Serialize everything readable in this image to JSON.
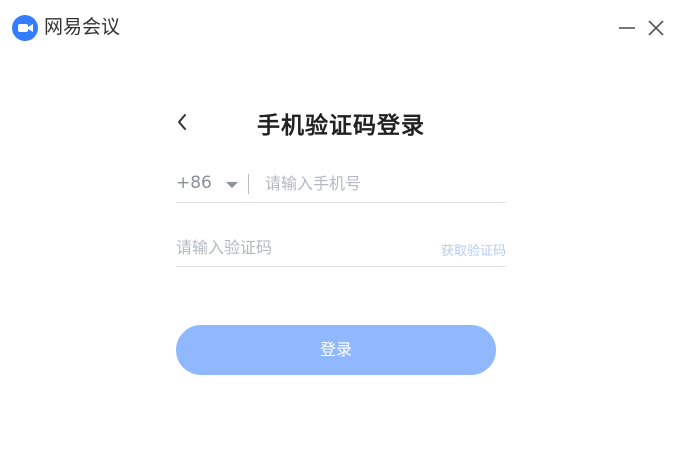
{
  "app": {
    "name": "网易会议",
    "icon": "camera-logo-icon",
    "brand_color": "#337eff"
  },
  "window_controls": {
    "minimize_icon": "minimize-icon",
    "close_icon": "close-icon"
  },
  "login": {
    "title": "手机验证码登录",
    "back_icon": "chevron-left-icon",
    "country_code": "+86",
    "phone_placeholder": "请输入手机号",
    "phone_value": "",
    "code_placeholder": "请输入验证码",
    "code_value": "",
    "get_code_label": "获取验证码",
    "submit_label": "登录",
    "submit_color": "#8fb8fe"
  }
}
